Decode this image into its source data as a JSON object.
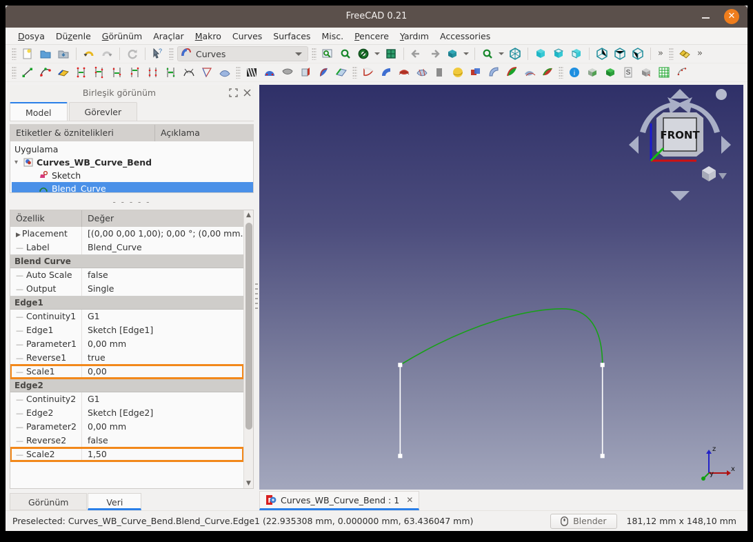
{
  "window": {
    "title": "FreeCAD 0.21",
    "minimize_label": "–",
    "close_label": "✕"
  },
  "menubar": {
    "items": [
      {
        "label": "Dosya",
        "mnemonic": "D"
      },
      {
        "label": "Düzenle",
        "mnemonic": "z"
      },
      {
        "label": "Görünüm",
        "mnemonic": "G"
      },
      {
        "label": "Araçlar",
        "mnemonic": ""
      },
      {
        "label": "Makro",
        "mnemonic": "M"
      },
      {
        "label": "Curves",
        "mnemonic": ""
      },
      {
        "label": "Surfaces",
        "mnemonic": ""
      },
      {
        "label": "Misc.",
        "mnemonic": ""
      },
      {
        "label": "Pencere",
        "mnemonic": "P"
      },
      {
        "label": "Yardım",
        "mnemonic": "Y"
      },
      {
        "label": "Accessories",
        "mnemonic": ""
      }
    ]
  },
  "toolbar": {
    "workbench_selector": {
      "value": "Curves",
      "icon": "curves-workbench-icon"
    },
    "overflow_label": "»"
  },
  "combo_view": {
    "title": "Birleşik görünüm",
    "float_icon": "expand-icon",
    "close_icon": "close-icon",
    "tabs": [
      {
        "label": "Model",
        "active": true
      },
      {
        "label": "Görevler",
        "active": false
      }
    ]
  },
  "tree": {
    "headers": [
      "Etiketler & öznitelikleri",
      "Açıklama"
    ],
    "root": "Uygulama",
    "items": [
      {
        "label": "Curves_WB_Curve_Bend",
        "level": 1,
        "selected": false,
        "bold": true,
        "icon": "document-icon"
      },
      {
        "label": "Sketch",
        "level": 2,
        "selected": false,
        "bold": false,
        "icon": "sketch-icon"
      },
      {
        "label": "Blend_Curve",
        "level": 2,
        "selected": true,
        "bold": false,
        "icon": "blend-curve-icon"
      }
    ],
    "separator": "- - - - -"
  },
  "property_editor": {
    "headers": [
      "Özellik",
      "Değer"
    ],
    "rows": [
      {
        "type": "prop",
        "name": "Placement",
        "value": "[(0,00 0,00 1,00); 0,00 °; (0,00 mm...",
        "expandable": true,
        "highlighted": false
      },
      {
        "type": "prop",
        "name": "Label",
        "value": "Blend_Curve",
        "expandable": false,
        "highlighted": false
      },
      {
        "type": "group",
        "name": "Blend Curve"
      },
      {
        "type": "prop",
        "name": "Auto Scale",
        "value": "false",
        "expandable": false,
        "highlighted": false
      },
      {
        "type": "prop",
        "name": "Output",
        "value": "Single",
        "expandable": false,
        "highlighted": false
      },
      {
        "type": "group",
        "name": "Edge1"
      },
      {
        "type": "prop",
        "name": "Continuity1",
        "value": "G1",
        "expandable": false,
        "highlighted": false
      },
      {
        "type": "prop",
        "name": "Edge1",
        "value": "Sketch [Edge1]",
        "expandable": false,
        "highlighted": false
      },
      {
        "type": "prop",
        "name": "Parameter1",
        "value": "0,00 mm",
        "expandable": false,
        "highlighted": false
      },
      {
        "type": "prop",
        "name": "Reverse1",
        "value": "true",
        "expandable": false,
        "highlighted": false
      },
      {
        "type": "prop",
        "name": "Scale1",
        "value": "0,00",
        "expandable": false,
        "highlighted": true
      },
      {
        "type": "group",
        "name": "Edge2"
      },
      {
        "type": "prop",
        "name": "Continuity2",
        "value": "G1",
        "expandable": false,
        "highlighted": false
      },
      {
        "type": "prop",
        "name": "Edge2",
        "value": "Sketch [Edge2]",
        "expandable": false,
        "highlighted": false
      },
      {
        "type": "prop",
        "name": "Parameter2",
        "value": "0,00 mm",
        "expandable": false,
        "highlighted": false
      },
      {
        "type": "prop",
        "name": "Reverse2",
        "value": "false",
        "expandable": false,
        "highlighted": false
      },
      {
        "type": "prop",
        "name": "Scale2",
        "value": "1,50",
        "expandable": false,
        "highlighted": true
      }
    ],
    "highlight_color": "#f2881a"
  },
  "property_tabs": [
    {
      "label": "Görünüm",
      "active": false
    },
    {
      "label": "Veri",
      "active": true
    }
  ],
  "viewport": {
    "navigation_cube_face": "FRONT",
    "axis_labels": {
      "x": "x",
      "y": "y",
      "z": "z"
    },
    "curve_color": "#1aa01a",
    "edge_color": "#ffffff",
    "background_top": "#2f3068",
    "background_bottom": "#a3a7bd"
  },
  "document_tabs": [
    {
      "label": "Curves_WB_Curve_Bend : 1",
      "close_label": "✕",
      "active": true,
      "icon": "freecad-document-icon"
    }
  ],
  "statusbar": {
    "message": "Preselected: Curves_WB_Curve_Bend.Blend_Curve.Edge1 (22.935308 mm, 0.000000 mm, 63.436047 mm)",
    "navigation_style": "Blender",
    "navigation_icon": "mouse-icon",
    "dimensions": "181,12 mm x 148,10 mm"
  }
}
